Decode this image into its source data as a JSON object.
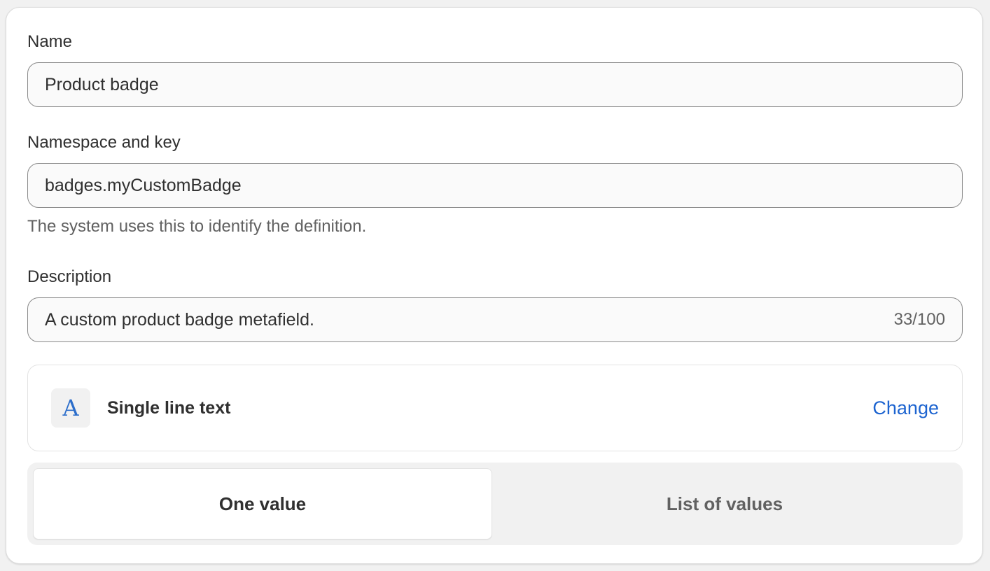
{
  "form": {
    "name_label": "Name",
    "name_value": "Product badge",
    "namespace_label": "Namespace and key",
    "namespace_value": "badges.myCustomBadge",
    "namespace_help": "The system uses this to identify the definition.",
    "description_label": "Description",
    "description_value": "A custom product badge metafield.",
    "description_counter": "33/100"
  },
  "type": {
    "icon": "A",
    "icon_name": "text-type-icon",
    "label": "Single line text",
    "change_label": "Change"
  },
  "value_mode": {
    "options": [
      "One value",
      "List of values"
    ],
    "selected": "One value"
  },
  "colors": {
    "accent": "#1d64d0",
    "icon": "#2c6ecb"
  }
}
